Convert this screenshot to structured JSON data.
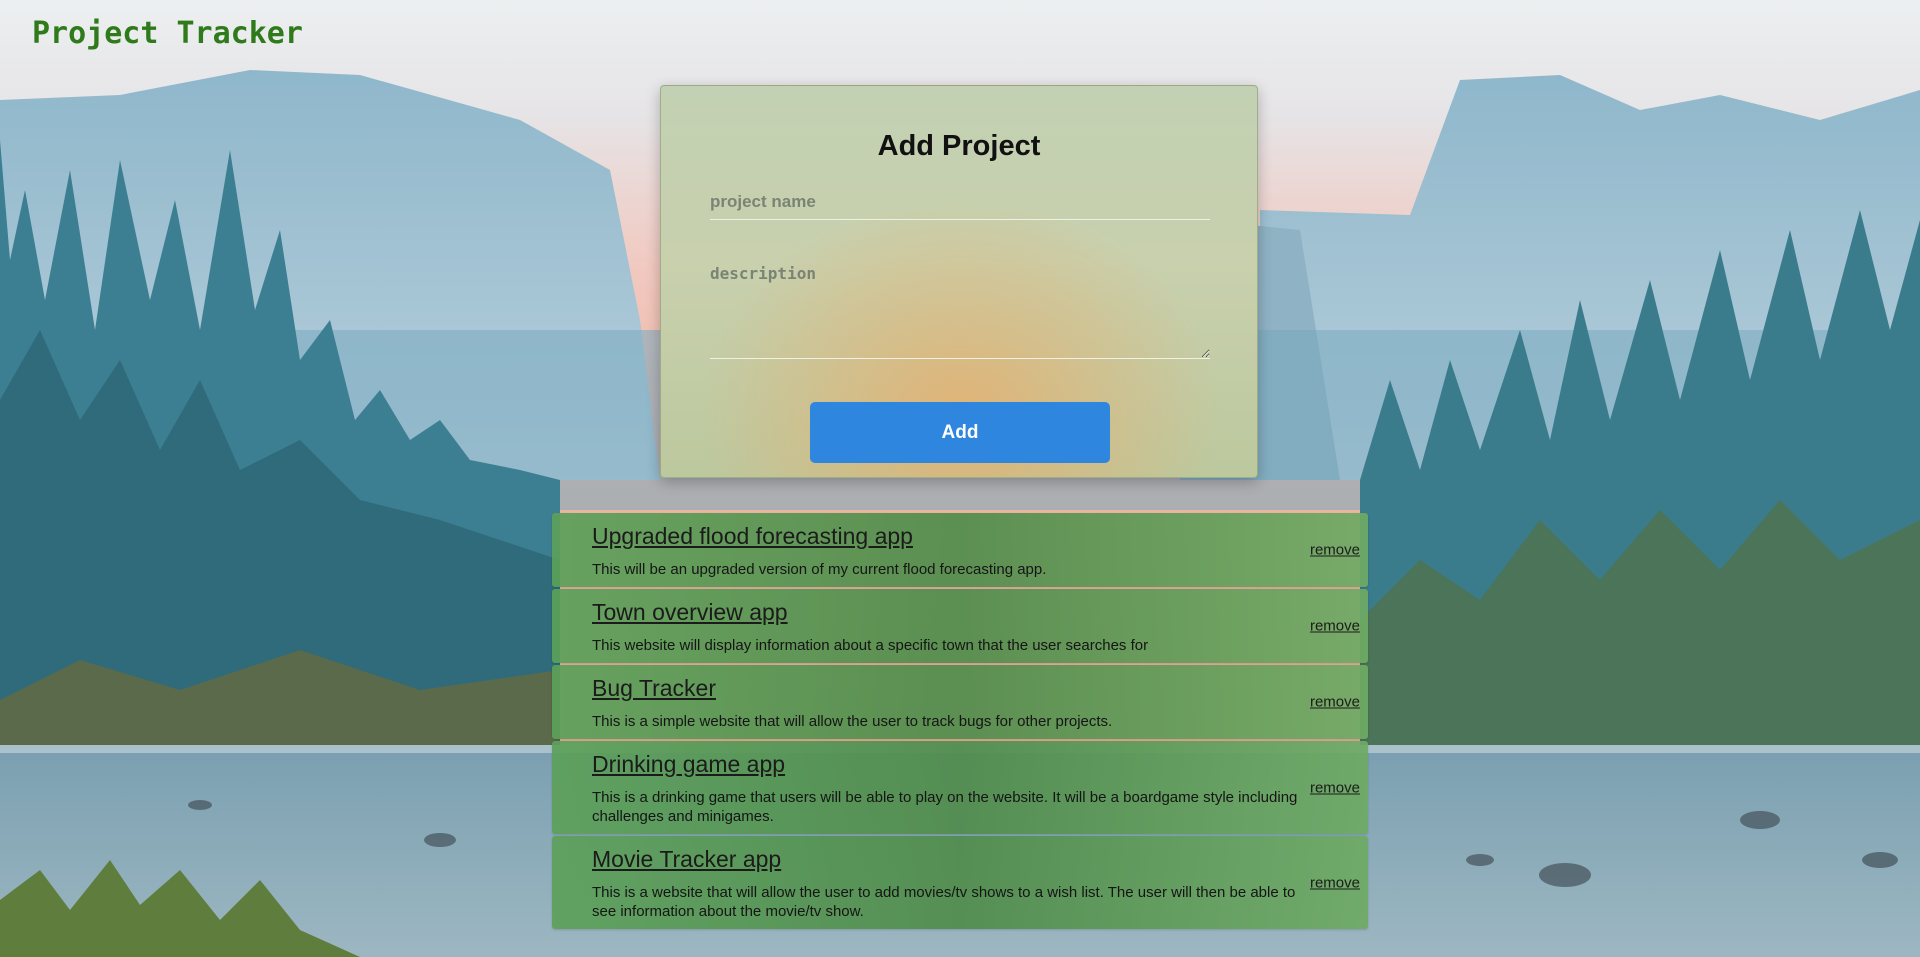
{
  "header": {
    "brand": "Project Tracker"
  },
  "form": {
    "title": "Add Project",
    "name_placeholder": "project name",
    "description_placeholder": "description",
    "add_label": "Add"
  },
  "projects": [
    {
      "title": "Upgraded flood forecasting app",
      "description": "This will be an upgraded version of my current flood forecasting app.",
      "remove_label": "remove"
    },
    {
      "title": "Town overview app",
      "description": "This website will display information about a specific town that the user searches for",
      "remove_label": "remove"
    },
    {
      "title": "Bug Tracker",
      "description": "This is a simple website that will allow the user to track bugs for other projects.",
      "remove_label": "remove"
    },
    {
      "title": "Drinking game app",
      "description": "This is a drinking game that users will be able to play on the website. It will be a boardgame style including challenges and minigames.",
      "remove_label": "remove"
    },
    {
      "title": "Movie Tracker app",
      "description": "This is a website that will allow the user to add movies/tv shows to a wish list. The user will then be able to see information about the movie/tv show.",
      "remove_label": "remove"
    }
  ]
}
